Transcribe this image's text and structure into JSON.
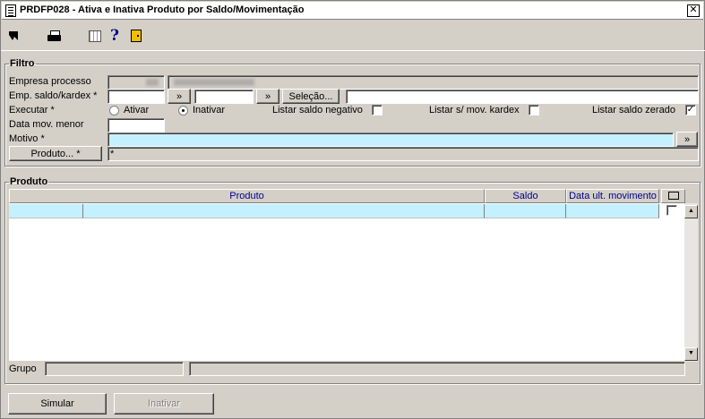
{
  "window": {
    "title": "PRDFP028 - Ativa e Inativa Produto por Saldo/Movimentação",
    "close_glyph": "✕"
  },
  "toolbar": {
    "help_glyph": "?"
  },
  "filtro": {
    "legend": "Filtro",
    "empresa_processo_label": "Empresa processo",
    "emp_saldo_label": "Emp. saldo/kardex *",
    "expand_glyph": "»",
    "selecao_label": "Seleção...",
    "executar_label": "Executar *",
    "ativar_label": "Ativar",
    "inativar_label": "Inativar",
    "executar_selected": "Inativar",
    "listar_saldo_negativo_label": "Listar saldo negativo",
    "listar_sem_mov_label": "Listar s/ mov. kardex",
    "listar_saldo_zerado_label": "Listar saldo zerado",
    "listar_saldo_negativo_checked": false,
    "listar_sem_mov_checked": false,
    "listar_saldo_zerado_checked": true,
    "check_glyph": "✓",
    "data_mov_menor_label": "Data mov. menor",
    "motivo_label": "Motivo *",
    "produto_button_label": "Produto... *",
    "produto_value": "*"
  },
  "produto": {
    "legend": "Produto",
    "columns": {
      "produto": "Produto",
      "saldo": "Saldo",
      "data_ult_movimento": "Data ult. movimento"
    },
    "grupo_label": "Grupo",
    "scroll_up_glyph": "▲",
    "scroll_down_glyph": "▼"
  },
  "actions": {
    "simular_label": "Simular",
    "inativar_label": "Inativar"
  }
}
